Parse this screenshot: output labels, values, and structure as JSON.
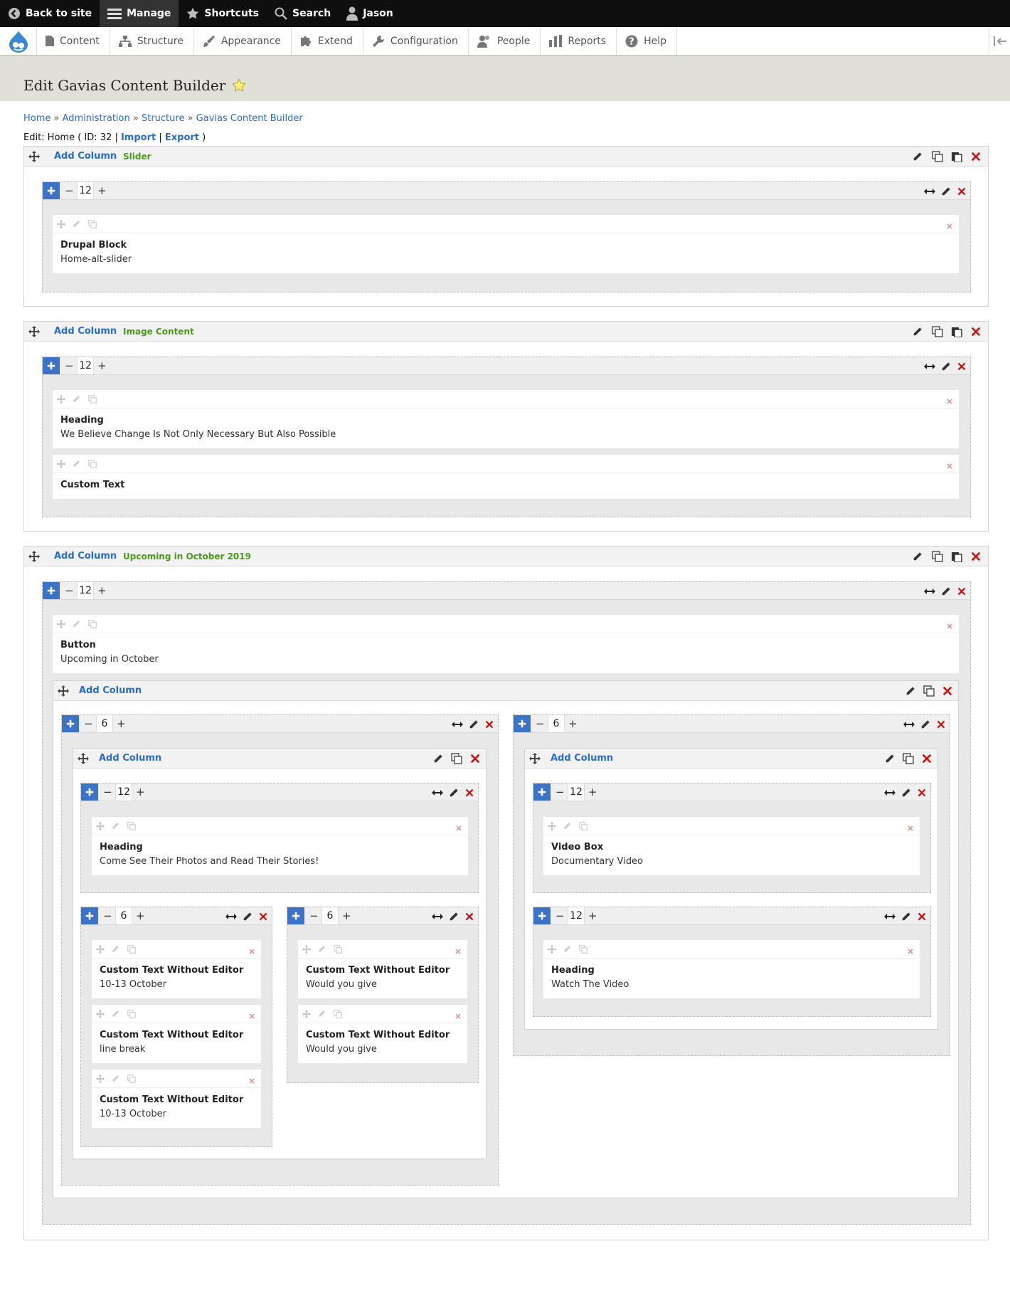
{
  "toolbar": {
    "back": "Back to site",
    "manage": "Manage",
    "shortcuts": "Shortcuts",
    "search": "Search",
    "user": "Jason"
  },
  "menu": [
    "Content",
    "Structure",
    "Appearance",
    "Extend",
    "Configuration",
    "People",
    "Reports",
    "Help"
  ],
  "page": {
    "title": "Edit Gavias Content Builder",
    "breadcrumb": [
      "Home",
      "Administration",
      "Structure",
      "Gavias Content Builder"
    ],
    "edit_prefix": "Edit: Home ( ID: 32 |",
    "import": "Import",
    "sep": "|",
    "export": "Export",
    "edit_suffix": ")"
  },
  "add_column": "Add Column",
  "rows": [
    {
      "label": "Slider"
    },
    {
      "label": "Image Content"
    },
    {
      "label": "Upcoming in October 2019"
    }
  ],
  "widths": [
    "12",
    "6"
  ],
  "elements": [
    {
      "title": "Drupal Block",
      "sub": "Home-alt-slider"
    },
    {
      "title": "Heading",
      "sub": "We Believe Change Is Not Only Necessary But Also Possible"
    },
    {
      "title": "Custom Text",
      "sub": ""
    },
    {
      "title": "Button",
      "sub": "Upcoming in October"
    },
    {
      "title": "Heading",
      "sub": "Come See Their Photos and Read Their Stories!"
    },
    {
      "title": "Custom Text Without Editor",
      "sub": "10-13 October"
    },
    {
      "title": "Custom Text Without Editor",
      "sub": "line break"
    },
    {
      "title": "Custom Text Without Editor",
      "sub": "10-13 October"
    },
    {
      "title": "Custom Text Without Editor",
      "sub": "Would you give"
    },
    {
      "title": "Custom Text Without Editor",
      "sub": "Would you give"
    },
    {
      "title": "Video Box",
      "sub": "Documentary Video"
    },
    {
      "title": "Heading",
      "sub": "Watch The Video"
    }
  ],
  "colors": {
    "accent": "#3c73c6",
    "link": "#2a6cc8",
    "label_green": "#4a9a1a",
    "delete_red": "#cc1111"
  },
  "icons": [
    "move-icon",
    "pencil-icon",
    "duplicate-icon",
    "paste-icon",
    "close-icon",
    "plus-icon",
    "resize-icon",
    "star-icon"
  ]
}
